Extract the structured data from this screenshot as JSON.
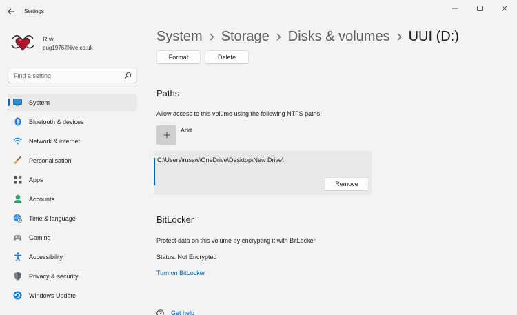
{
  "app": {
    "title": "Settings"
  },
  "user": {
    "name": "R w",
    "email": "pug1976@live.co.uk"
  },
  "search": {
    "placeholder": "Find a setting"
  },
  "nav": {
    "items": [
      {
        "label": "System",
        "icon": "monitor-icon",
        "selected": true
      },
      {
        "label": "Bluetooth & devices",
        "icon": "bluetooth-icon"
      },
      {
        "label": "Network & internet",
        "icon": "wifi-icon"
      },
      {
        "label": "Personalisation",
        "icon": "brush-icon"
      },
      {
        "label": "Apps",
        "icon": "apps-icon"
      },
      {
        "label": "Accounts",
        "icon": "person-icon"
      },
      {
        "label": "Time & language",
        "icon": "globe-clock-icon"
      },
      {
        "label": "Gaming",
        "icon": "gamepad-icon"
      },
      {
        "label": "Accessibility",
        "icon": "accessibility-icon"
      },
      {
        "label": "Privacy & security",
        "icon": "shield-icon"
      },
      {
        "label": "Windows Update",
        "icon": "update-icon"
      }
    ]
  },
  "breadcrumb": [
    "System",
    "Storage",
    "Disks & volumes",
    "UUI (D:)"
  ],
  "actions": {
    "format": "Format",
    "delete": "Delete"
  },
  "paths": {
    "title": "Paths",
    "description": "Allow access to this volume using the following NTFS paths.",
    "add_label": "Add",
    "entry": "C:\\Users\\russw\\OneDrive\\Desktop\\New Drive\\",
    "remove_label": "Remove"
  },
  "bitlocker": {
    "title": "BitLocker",
    "description": "Protect data on this volume by encrypting it with BitLocker",
    "status": "Status: Not Encrypted",
    "turn_on": "Turn on BitLocker"
  },
  "help": {
    "label": "Get help"
  },
  "colors": {
    "accent": "#0067c0",
    "link": "#0063b1",
    "background": "#f3f3f3"
  }
}
